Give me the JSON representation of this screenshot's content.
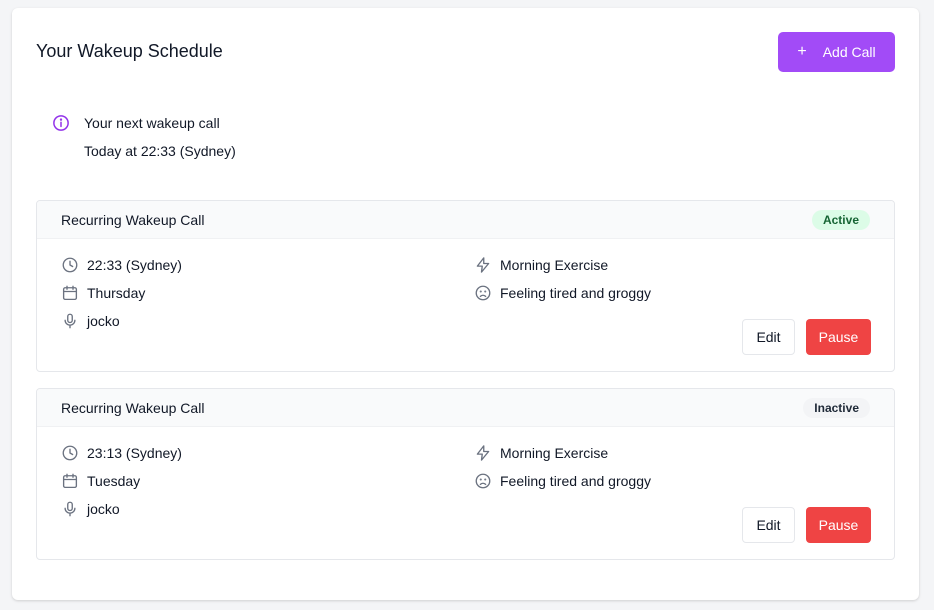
{
  "header": {
    "title": "Your Wakeup Schedule",
    "add_button_label": "Add Call",
    "add_button_icon": "+"
  },
  "next_call": {
    "title": "Your next wakeup call",
    "detail": "Today at 22:33 (Sydney)"
  },
  "colors": {
    "accent": "#a24bf7",
    "danger": "#ef4444",
    "active_badge_bg": "#dcfce7",
    "active_badge_text": "#166534"
  },
  "calls": [
    {
      "title": "Recurring Wakeup Call",
      "status": "Active",
      "time": "22:33 (Sydney)",
      "day": "Thursday",
      "voice": "jocko",
      "routine": "Morning Exercise",
      "mood": "Feeling tired and groggy",
      "edit_label": "Edit",
      "pause_label": "Pause"
    },
    {
      "title": "Recurring Wakeup Call",
      "status": "Inactive",
      "time": "23:13 (Sydney)",
      "day": "Tuesday",
      "voice": "jocko",
      "routine": "Morning Exercise",
      "mood": "Feeling tired and groggy",
      "edit_label": "Edit",
      "pause_label": "Pause"
    }
  ]
}
